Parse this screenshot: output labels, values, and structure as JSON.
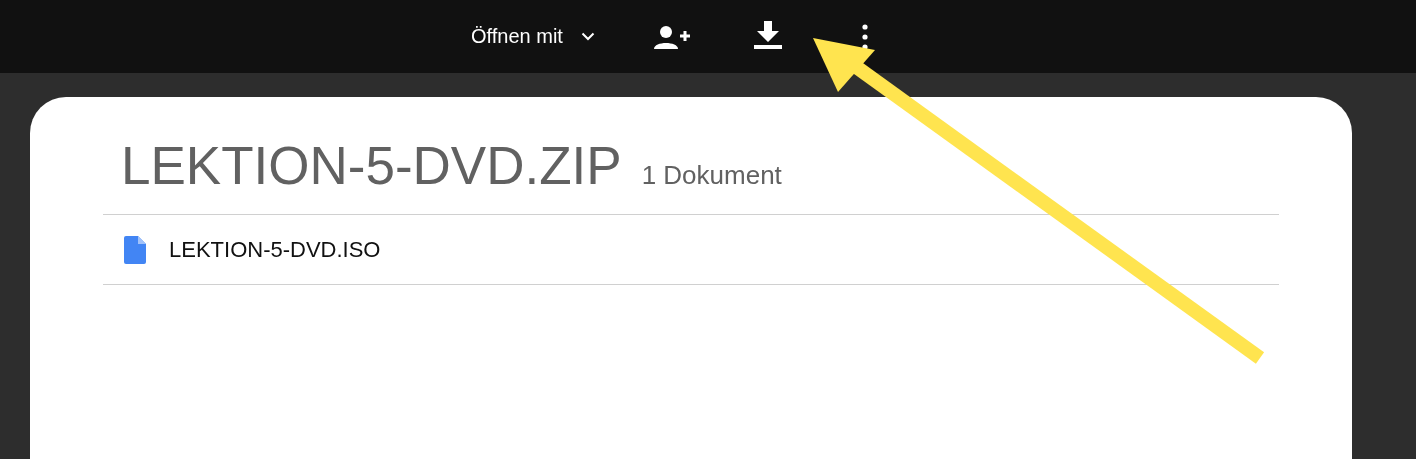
{
  "toolbar": {
    "open_with": "Öffnen mit"
  },
  "archive": {
    "title": "LEKTION-5-DVD.ZIP",
    "count": "1 Dokument"
  },
  "files": [
    {
      "name": "LEKTION-5-DVD.ISO"
    }
  ]
}
